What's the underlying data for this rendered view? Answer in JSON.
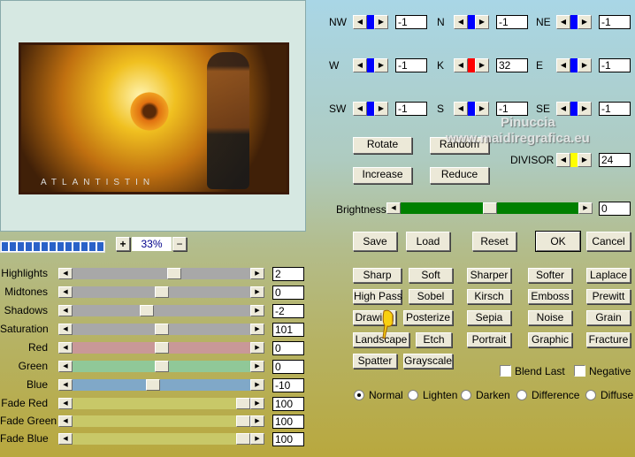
{
  "preview": {
    "logo_text": "ATLANTISTIN",
    "zoom": "33%",
    "zoom_in": "+",
    "zoom_out": "−"
  },
  "matrix": [
    {
      "label": "NW",
      "value": "-1",
      "color": "#0000ff"
    },
    {
      "label": "N",
      "value": "-1",
      "color": "#0000ff"
    },
    {
      "label": "NE",
      "value": "-1",
      "color": "#0000ff"
    },
    {
      "label": "W",
      "value": "-1",
      "color": "#0000ff"
    },
    {
      "label": "K",
      "value": "32",
      "color": "#ff0000"
    },
    {
      "label": "E",
      "value": "-1",
      "color": "#0000ff"
    },
    {
      "label": "SW",
      "value": "-1",
      "color": "#0000ff"
    },
    {
      "label": "S",
      "value": "-1",
      "color": "#0000ff"
    },
    {
      "label": "SE",
      "value": "-1",
      "color": "#0000ff"
    }
  ],
  "buttons": {
    "rotate": "Rotate",
    "random": "Random",
    "increase": "Increase",
    "reduce": "Reduce",
    "save": "Save",
    "load": "Load",
    "reset": "Reset",
    "ok": "OK",
    "cancel": "Cancel"
  },
  "divisor": {
    "label": "DIVISOR",
    "value": "24",
    "color": "#ffff00"
  },
  "brightness": {
    "label": "Brightness",
    "value": "0",
    "fraction": 0.5
  },
  "watermark": {
    "line1": "Pinuccia",
    "line2": "www.maidiregrafica.eu"
  },
  "adjust": [
    {
      "label": "Highlights",
      "value": "2",
      "fraction": 0.58,
      "color": "#a8a8a8"
    },
    {
      "label": "Midtones",
      "value": "0",
      "fraction": 0.5,
      "color": "#a8a8a8"
    },
    {
      "label": "Shadows",
      "value": "-2",
      "fraction": 0.41,
      "color": "#a8a8a8"
    },
    {
      "label": "Saturation",
      "value": "101",
      "fraction": 0.5,
      "color": "#a8a8a8"
    },
    {
      "label": "Red",
      "value": "0",
      "fraction": 0.5,
      "color": "#c99898"
    },
    {
      "label": "Green",
      "value": "0",
      "fraction": 0.5,
      "color": "#90c898"
    },
    {
      "label": "Blue",
      "value": "-10",
      "fraction": 0.45,
      "color": "#80a8c8"
    },
    {
      "label": "Fade Red",
      "value": "100",
      "fraction": 1,
      "color": "#c8c868"
    },
    {
      "label": "Fade Green",
      "value": "100",
      "fraction": 1,
      "color": "#c8c868"
    },
    {
      "label": "Fade Blue",
      "value": "100",
      "fraction": 1,
      "color": "#c8c868"
    }
  ],
  "presets": [
    "Sharp",
    "Soft",
    "Sharper",
    "Softer",
    "Laplace",
    "High Pass",
    "Sobel",
    "Kirsch",
    "Emboss",
    "Prewitt",
    "Drawing",
    "Posterize",
    "Sepia",
    "Noise",
    "Grain",
    "Landscape",
    "Etch",
    "Portrait",
    "Graphic",
    "Fracture",
    "Spatter",
    "Grayscale"
  ],
  "checkboxes": [
    {
      "label": "Blend Last",
      "checked": false
    },
    {
      "label": "Negative",
      "checked": false
    }
  ],
  "modes": [
    {
      "label": "Normal",
      "selected": true
    },
    {
      "label": "Lighten",
      "selected": false
    },
    {
      "label": "Darken",
      "selected": false
    },
    {
      "label": "Difference",
      "selected": false
    },
    {
      "label": "Diffuse",
      "selected": false
    }
  ]
}
